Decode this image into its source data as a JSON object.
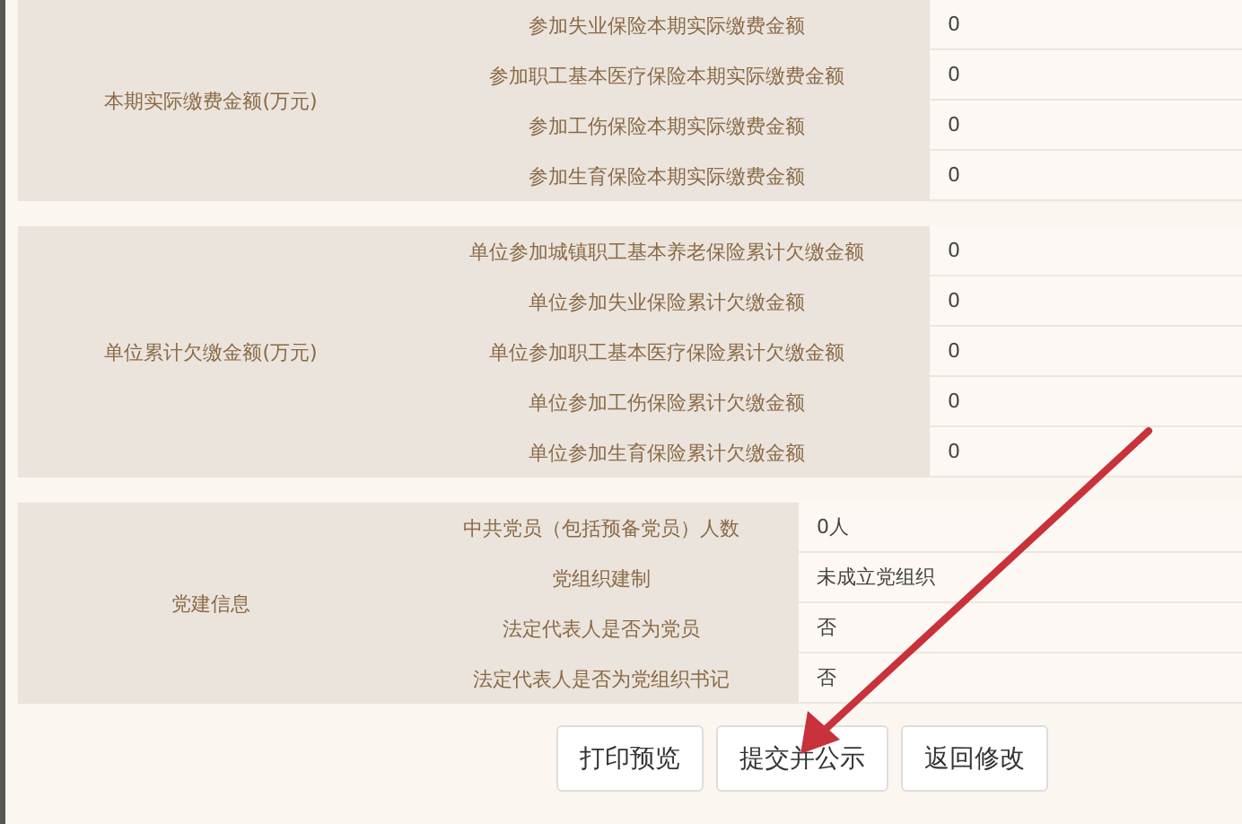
{
  "sections": [
    {
      "label": "本期实际缴费金额(万元)",
      "rows": [
        {
          "field": "参加失业保险本期实际缴费金额",
          "value": "0"
        },
        {
          "field": "参加职工基本医疗保险本期实际缴费金额",
          "value": "0"
        },
        {
          "field": "参加工伤保险本期实际缴费金额",
          "value": "0"
        },
        {
          "field": "参加生育保险本期实际缴费金额",
          "value": "0"
        }
      ]
    },
    {
      "label": "单位累计欠缴金额(万元)",
      "rows": [
        {
          "field": "单位参加城镇职工基本养老保险累计欠缴金额",
          "value": "0"
        },
        {
          "field": "单位参加失业保险累计欠缴金额",
          "value": "0"
        },
        {
          "field": "单位参加职工基本医疗保险累计欠缴金额",
          "value": "0"
        },
        {
          "field": "单位参加工伤保险累计欠缴金额",
          "value": "0"
        },
        {
          "field": "单位参加生育保险累计欠缴金额",
          "value": "0"
        }
      ]
    },
    {
      "label": "党建信息",
      "rows": [
        {
          "field": "中共党员（包括预备党员）人数",
          "value": "0人"
        },
        {
          "field": "党组织建制",
          "value": "未成立党组织"
        },
        {
          "field": "法定代表人是否为党员",
          "value": "否"
        },
        {
          "field": "法定代表人是否为党组织书记",
          "value": "否"
        }
      ]
    }
  ],
  "buttons": [
    "打印预览",
    "提交并公示",
    "返回修改"
  ]
}
